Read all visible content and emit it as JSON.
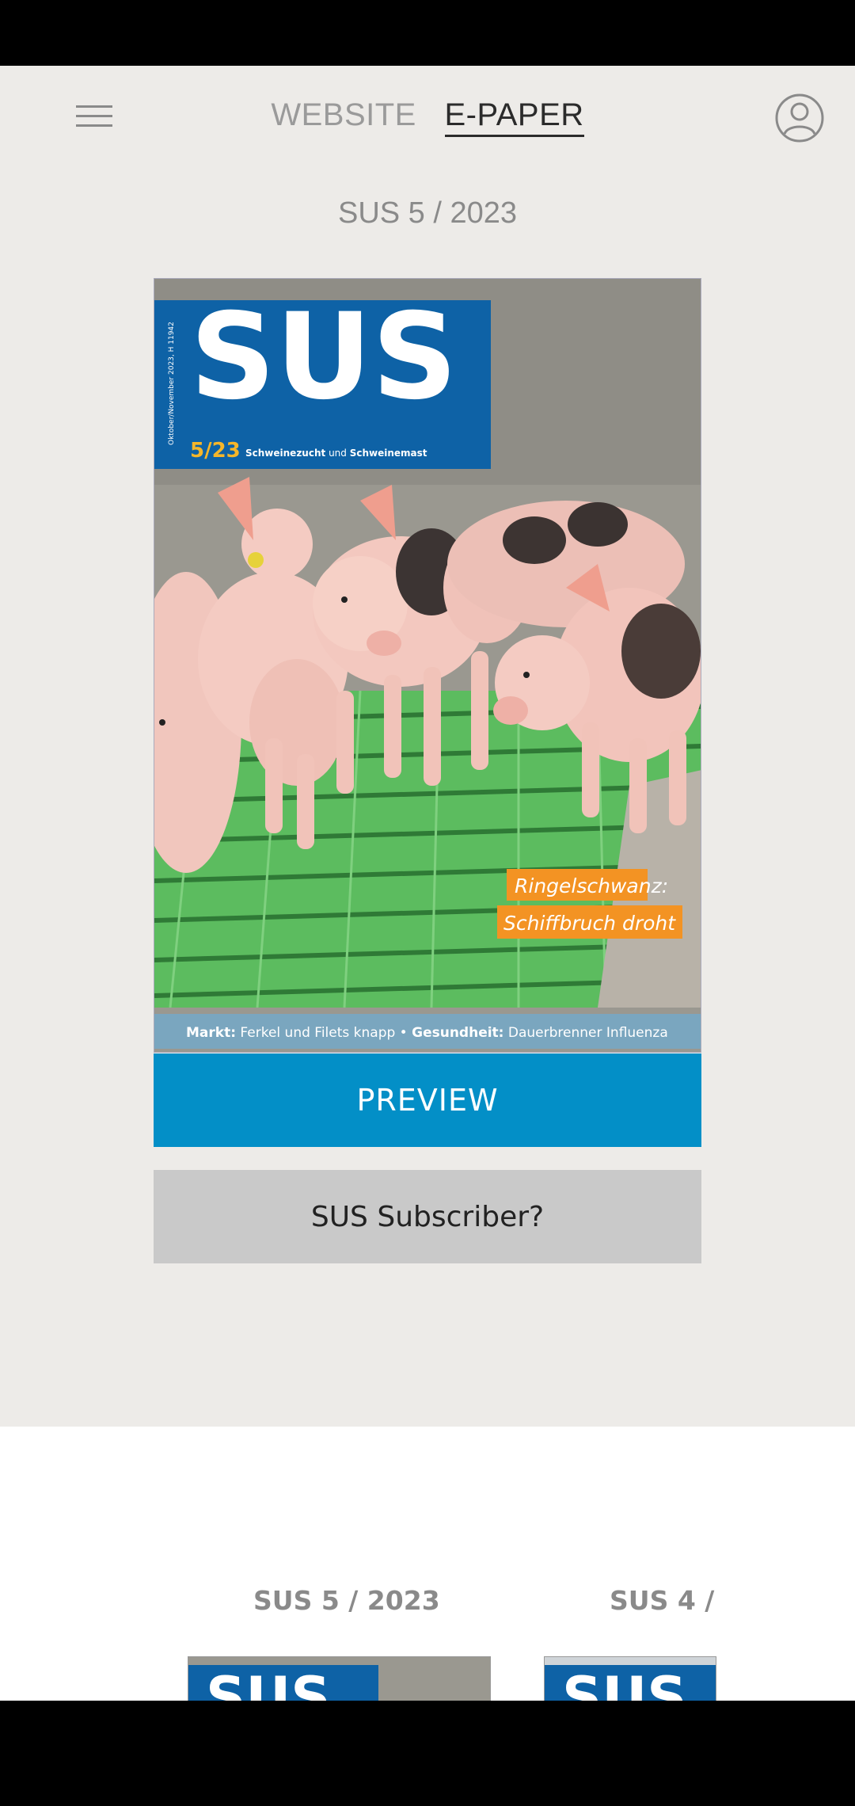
{
  "header": {
    "tabs": [
      {
        "label": "WEBSITE",
        "active": false
      },
      {
        "label": "E-PAPER",
        "active": true
      }
    ]
  },
  "current_issue": {
    "title": "SUS 5 / 2023",
    "cover": {
      "masthead": "SUS",
      "issue_number": "5/23",
      "subtitle_bold_1": "Schweinezucht",
      "subtitle_mid": " und ",
      "subtitle_bold_2": "Schweinemast",
      "side_text": "Oktober/November 2023, H 11942",
      "headline_line1": "Ringelschwanz:",
      "headline_line2": "Schiffbruch droht",
      "footer_label_1": "Markt:",
      "footer_text_1": " Ferkel und Filets knapp • ",
      "footer_label_2": "Gesundheit:",
      "footer_text_2": " Dauerbrenner Influenza"
    },
    "preview_label": "PREVIEW",
    "subscriber_label": "SUS Subscriber?"
  },
  "archive": {
    "items": [
      {
        "title": "SUS 5 / 2023"
      },
      {
        "title": "SUS 4 /"
      }
    ]
  },
  "colors": {
    "accent": "#038fc7",
    "background": "#edebe8",
    "cover_blue": "#0e62a6",
    "cover_orange": "#f39323"
  }
}
